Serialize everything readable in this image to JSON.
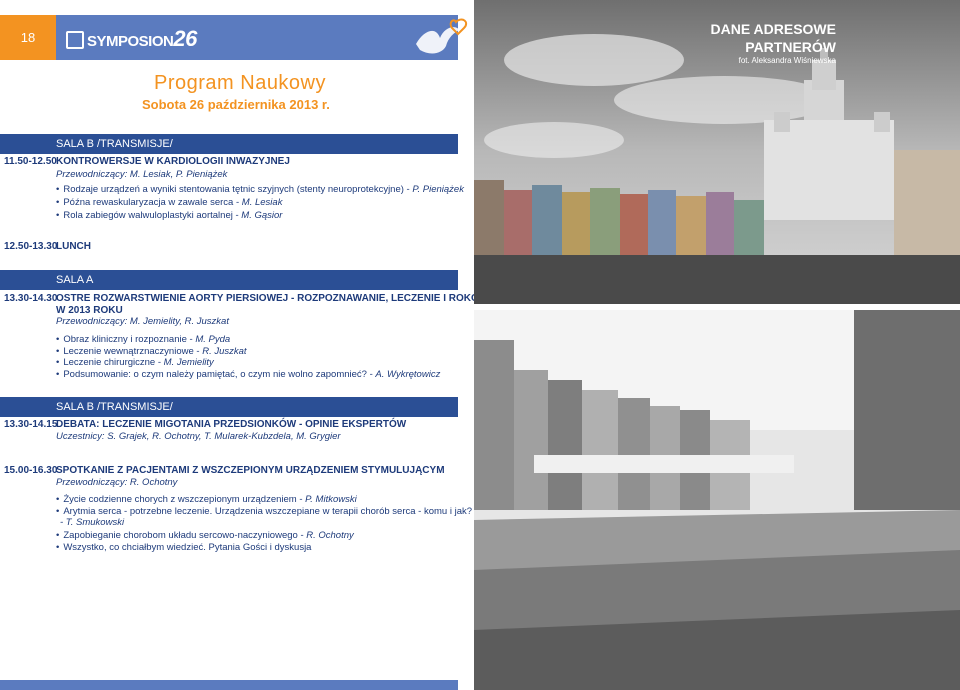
{
  "header": {
    "page_number": "18",
    "logo_text": "SYMPOSION",
    "logo_number": "26",
    "brand_color": "#5b7bbf",
    "accent_color": "#f39321"
  },
  "title": {
    "main": "Program Naukowy",
    "date": "Sobota 26 października 2013 r."
  },
  "sessions": [
    {
      "sala": "SALA B /TRANSMISJE/",
      "time": "11.50-12.50",
      "title": "KONTROWERSJE W KARDIOLOGII INWAZYJNEJ",
      "chair": "Przewodniczący: M. Lesiak, P. Pieniążek",
      "items": [
        {
          "text": "Rodzaje urządzeń a wyniki stentowania tętnic szyjnych (stenty neuroprotekcyjne) - ",
          "name": "P. Pieniążek"
        },
        {
          "text": "Późna rewaskularyzacja w zawale serca - ",
          "name": "M. Lesiak"
        },
        {
          "text": "Rola zabiegów walwuloplastyki aortalnej - ",
          "name": "M. Gąsior"
        }
      ]
    }
  ],
  "lunch": {
    "time": "12.50-13.30",
    "label": "LUNCH"
  },
  "session_a": {
    "sala": "SALA A",
    "time": "13.30-14.30",
    "title_line1": "OSTRE ROZWARSTWIENIE AORTY PIERSIOWEJ - ROZPOZNAWANIE, LECZENIE I ROKOWANIE",
    "title_line2": "W 2013 ROKU",
    "chair": "Przewodniczący: M. Jemielity, R. Juszkat",
    "items": [
      {
        "text": "Obraz kliniczny i rozpoznanie - ",
        "name": "M. Pyda"
      },
      {
        "text": "Leczenie wewnątrznaczyniowe - ",
        "name": "R. Juszkat"
      },
      {
        "text": "Leczenie chirurgiczne - ",
        "name": "M. Jemielity"
      },
      {
        "text": "Podsumowanie: o czym należy pamiętać, o czym nie wolno zapomnieć? - ",
        "name": "A. Wykrętowicz"
      }
    ]
  },
  "session_b2": {
    "sala": "SALA B /TRANSMISJE/",
    "time": "13.30-14.15",
    "title": "DEBATA: LECZENIE MIGOTANIA PRZEDSIONKÓW - OPINIE EKSPERTÓW",
    "chair": "Uczestnicy: S. Grajek, R. Ochotny, T. Mularek-Kubzdela, M. Grygier"
  },
  "session_b3": {
    "time": "15.00-16.30",
    "title": "SPOTKANIE Z PACJENTAMI Z WSZCZEPIONYM URZĄDZENIEM STYMULUJĄCYM",
    "chair": "Przewodniczący: R. Ochotny",
    "items": [
      {
        "text": "Życie codzienne chorych z wszczepionym urządzeniem - ",
        "name": "P. Mitkowski"
      },
      {
        "text": "Arytmia serca - potrzebne leczenie. Urządzenia wszczepiane w terapii chorób serca - komu i jak?",
        "name": ""
      },
      {
        "text": "Zapobieganie chorobom układu sercowo-naczyniowego - ",
        "name": "R. Ochotny"
      },
      {
        "text": "Wszystko, co chciałbym wiedzieć. Pytania Gości i dyskusja",
        "name": ""
      }
    ],
    "continuation": "- T. Smukowski"
  },
  "right": {
    "dane": "DANE ADRESOWE",
    "partners": "PARTNERÓW",
    "credit": "fot. Aleksandra Wiśniewska"
  }
}
